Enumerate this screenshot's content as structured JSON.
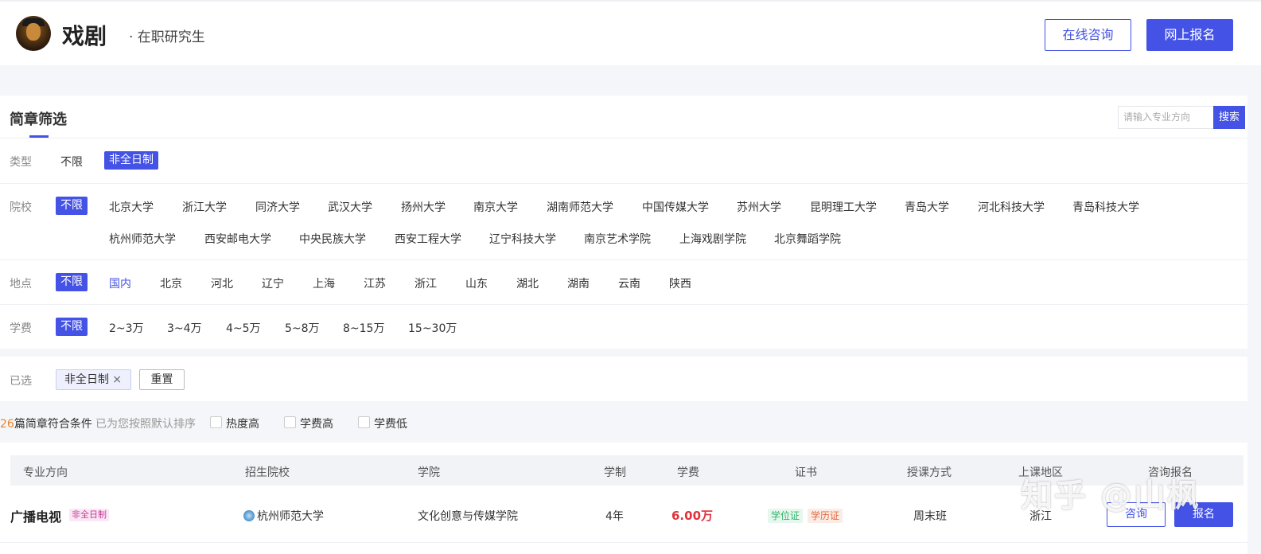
{
  "header": {
    "title": "戏剧",
    "subtitle": "· 在职研究生",
    "consult_label": "在线咨询",
    "apply_label": "网上报名"
  },
  "filter": {
    "title": "简章筛选",
    "search_placeholder": "请输入专业方向",
    "search_button": "搜索",
    "type": {
      "label": "类型",
      "options": [
        "不限",
        "非全日制"
      ],
      "selected": "非全日制"
    },
    "school": {
      "label": "院校",
      "options": [
        "不限",
        "北京大学",
        "浙江大学",
        "同济大学",
        "武汉大学",
        "扬州大学",
        "南京大学",
        "湖南师范大学",
        "中国传媒大学",
        "苏州大学",
        "昆明理工大学",
        "青岛大学",
        "河北科技大学",
        "青岛科技大学",
        "杭州师范大学",
        "西安邮电大学",
        "中央民族大学",
        "西安工程大学",
        "辽宁科技大学",
        "南京艺术学院",
        "上海戏剧学院",
        "北京舞蹈学院"
      ],
      "selected": "不限"
    },
    "location": {
      "label": "地点",
      "options": [
        "不限",
        "国内",
        "北京",
        "河北",
        "辽宁",
        "上海",
        "江苏",
        "浙江",
        "山东",
        "湖北",
        "湖南",
        "云南",
        "陕西"
      ],
      "selected": "不限"
    },
    "fee": {
      "label": "学费",
      "options": [
        "不限",
        "2~3万",
        "3~4万",
        "4~5万",
        "5~8万",
        "8~15万",
        "15~30万"
      ],
      "selected": "不限"
    }
  },
  "selected": {
    "label": "已选",
    "chip": "非全日制",
    "chip_close": "×",
    "reset": "重置"
  },
  "results": {
    "count": "26",
    "count_suffix": "篇简章符合条件",
    "hint": "已为您按照默认排序",
    "sort_options": [
      "热度高",
      "学费高",
      "学费低"
    ]
  },
  "table": {
    "headers": [
      "专业方向",
      "招生院校",
      "学院",
      "学制",
      "学费",
      "证书",
      "授课方式",
      "上课地区",
      "咨询报名"
    ],
    "rows": [
      {
        "major": "广播电视",
        "badge": "非全日制",
        "school": "杭州师范大学",
        "college": "文化创意与传媒学院",
        "duration": "4年",
        "fee": "6.00万",
        "certs": [
          "学位证",
          "学历证"
        ],
        "mode": "周末班",
        "region": "浙江",
        "consult": "咨询",
        "apply": "报名"
      }
    ]
  },
  "watermark": "知乎 @山枫",
  "colors": {
    "accent": "#4452e6",
    "fee": "#e0323c",
    "count": "#e8852e"
  }
}
